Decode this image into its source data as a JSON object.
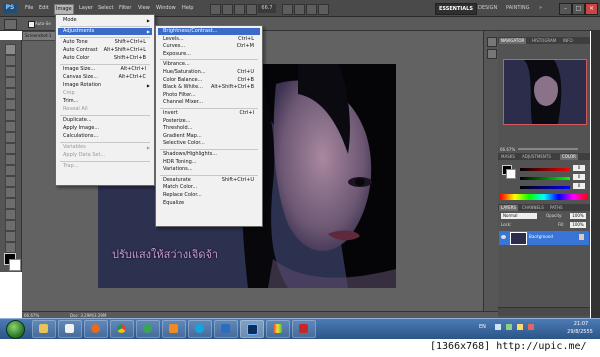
{
  "app": {
    "logo": "PS",
    "menus": [
      "File",
      "Edit",
      "Image",
      "Layer",
      "Select",
      "Filter",
      "View",
      "Window",
      "Help"
    ],
    "zoom": "66.7",
    "workspaces": [
      "ESSENTIALS",
      "DESIGN",
      "PAINTING",
      "»"
    ],
    "options_bar": {
      "auto_select_label": "Auto-Se"
    },
    "document_tab": "Screenshot-1",
    "status": {
      "zoom": "66.67%",
      "doc": "Doc: 3.29M/3.29M"
    }
  },
  "image_menu": {
    "items": [
      {
        "label": "Mode",
        "submenu": true,
        "disabled": false
      },
      {
        "separator": true
      },
      {
        "label": "Adjustments",
        "submenu": true,
        "highlighted": true
      },
      {
        "separator": true
      },
      {
        "label": "Auto Tone",
        "shortcut": "Shift+Ctrl+L"
      },
      {
        "label": "Auto Contrast",
        "shortcut": "Alt+Shift+Ctrl+L"
      },
      {
        "label": "Auto Color",
        "shortcut": "Shift+Ctrl+B"
      },
      {
        "separator": true
      },
      {
        "label": "Image Size...",
        "shortcut": "Alt+Ctrl+I"
      },
      {
        "label": "Canvas Size...",
        "shortcut": "Alt+Ctrl+C"
      },
      {
        "label": "Image Rotation",
        "submenu": true
      },
      {
        "label": "Crop",
        "disabled": true
      },
      {
        "label": "Trim..."
      },
      {
        "label": "Reveal All",
        "disabled": true
      },
      {
        "separator": true
      },
      {
        "label": "Duplicate..."
      },
      {
        "label": "Apply Image..."
      },
      {
        "label": "Calculations..."
      },
      {
        "separator": true
      },
      {
        "label": "Variables",
        "submenu": true,
        "disabled": true
      },
      {
        "label": "Apply Data Set...",
        "disabled": true
      },
      {
        "separator": true
      },
      {
        "label": "Trap...",
        "disabled": true
      }
    ]
  },
  "adjustments_menu": {
    "items": [
      {
        "label": "Brightness/Contrast...",
        "highlighted": true
      },
      {
        "label": "Levels...",
        "shortcut": "Ctrl+L"
      },
      {
        "label": "Curves...",
        "shortcut": "Ctrl+M"
      },
      {
        "label": "Exposure..."
      },
      {
        "separator": true
      },
      {
        "label": "Vibrance..."
      },
      {
        "label": "Hue/Saturation...",
        "shortcut": "Ctrl+U"
      },
      {
        "label": "Color Balance...",
        "shortcut": "Ctrl+B"
      },
      {
        "label": "Black & White...",
        "shortcut": "Alt+Shift+Ctrl+B"
      },
      {
        "label": "Photo Filter..."
      },
      {
        "label": "Channel Mixer..."
      },
      {
        "separator": true
      },
      {
        "label": "Invert",
        "shortcut": "Ctrl+I"
      },
      {
        "label": "Posterize..."
      },
      {
        "label": "Threshold..."
      },
      {
        "label": "Gradient Map..."
      },
      {
        "label": "Selective Color..."
      },
      {
        "separator": true
      },
      {
        "label": "Shadows/Highlights..."
      },
      {
        "label": "HDR Toning..."
      },
      {
        "label": "Variations..."
      },
      {
        "separator": true
      },
      {
        "label": "Desaturate",
        "shortcut": "Shift+Ctrl+U"
      },
      {
        "label": "Match Color..."
      },
      {
        "label": "Replace Color..."
      },
      {
        "label": "Equalize"
      }
    ]
  },
  "canvas": {
    "caption": "ปรับแสงให้สว่างเจิดจ้า"
  },
  "panels": {
    "navigator_tabs": [
      "NAVIGATOR",
      "HISTOGRAM",
      "INFO"
    ],
    "navigator_zoom": "66.67%",
    "color_tabs": [
      "MASKS",
      "ADJUSTMENTS",
      "COLOR"
    ],
    "color_values": {
      "r": "0",
      "g": "0",
      "b": "0"
    },
    "layers_tabs": [
      "LAYERS",
      "CHANNELS",
      "PATHS"
    ],
    "blend_mode": "Normal",
    "opacity_label": "Opacity:",
    "opacity": "100%",
    "lock_label": "Lock:",
    "fill_label": "Fill:",
    "fill": "100%",
    "layer_name": "Background"
  },
  "taskbar": {
    "lang": "EN",
    "time": "21:07",
    "date": "29/8/2555"
  },
  "watermark": "[1366x768] http://upic.me/",
  "colors": {
    "menu_highlight": "#3a6bc9",
    "taskbar": "#2a5387",
    "canvas": "#2a2d4a",
    "caption": "#c79ad6"
  }
}
